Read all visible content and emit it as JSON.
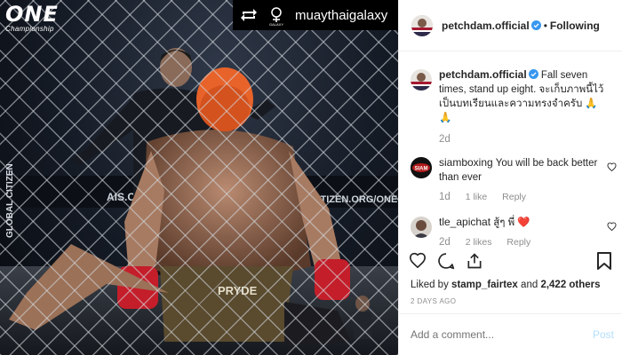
{
  "photo": {
    "logo_text": "ONE",
    "logo_sub": "Championship",
    "repost_handle": "muaythaigalaxy",
    "repost_badge": "GALAXY"
  },
  "header": {
    "username": "petchdam.official",
    "separator": "•",
    "follow_status": "Following"
  },
  "caption": {
    "username": "petchdam.official",
    "text": "Fall seven times, stand up eight. จะเก็บภาพนี้ไว้เป็นบทเรียนและความทรงจำครับ 🙏🙏",
    "age": "2d"
  },
  "comments": [
    {
      "username": "siamboxing",
      "text": "You will be back better than ever",
      "age": "1d",
      "likes": "1 like",
      "reply": "Reply",
      "avatar_text": "SIAM"
    },
    {
      "username": "tle_apichat",
      "text": "สู้ๆ พี่ ❤️",
      "age": "2d",
      "likes": "2 likes",
      "reply": "Reply"
    }
  ],
  "likes_line": {
    "prefix": "Liked by",
    "user": "stamp_fairtex",
    "middle": "and",
    "others": "2,422 others"
  },
  "timestamp": "2 DAYS AGO",
  "comment_input": {
    "placeholder": "Add a comment..."
  },
  "post_button": "Post",
  "colors": {
    "verified": "#3897f0",
    "heart": "#ed4956",
    "post_disabled": "#b2dffc",
    "muted": "#8e8e8e"
  }
}
